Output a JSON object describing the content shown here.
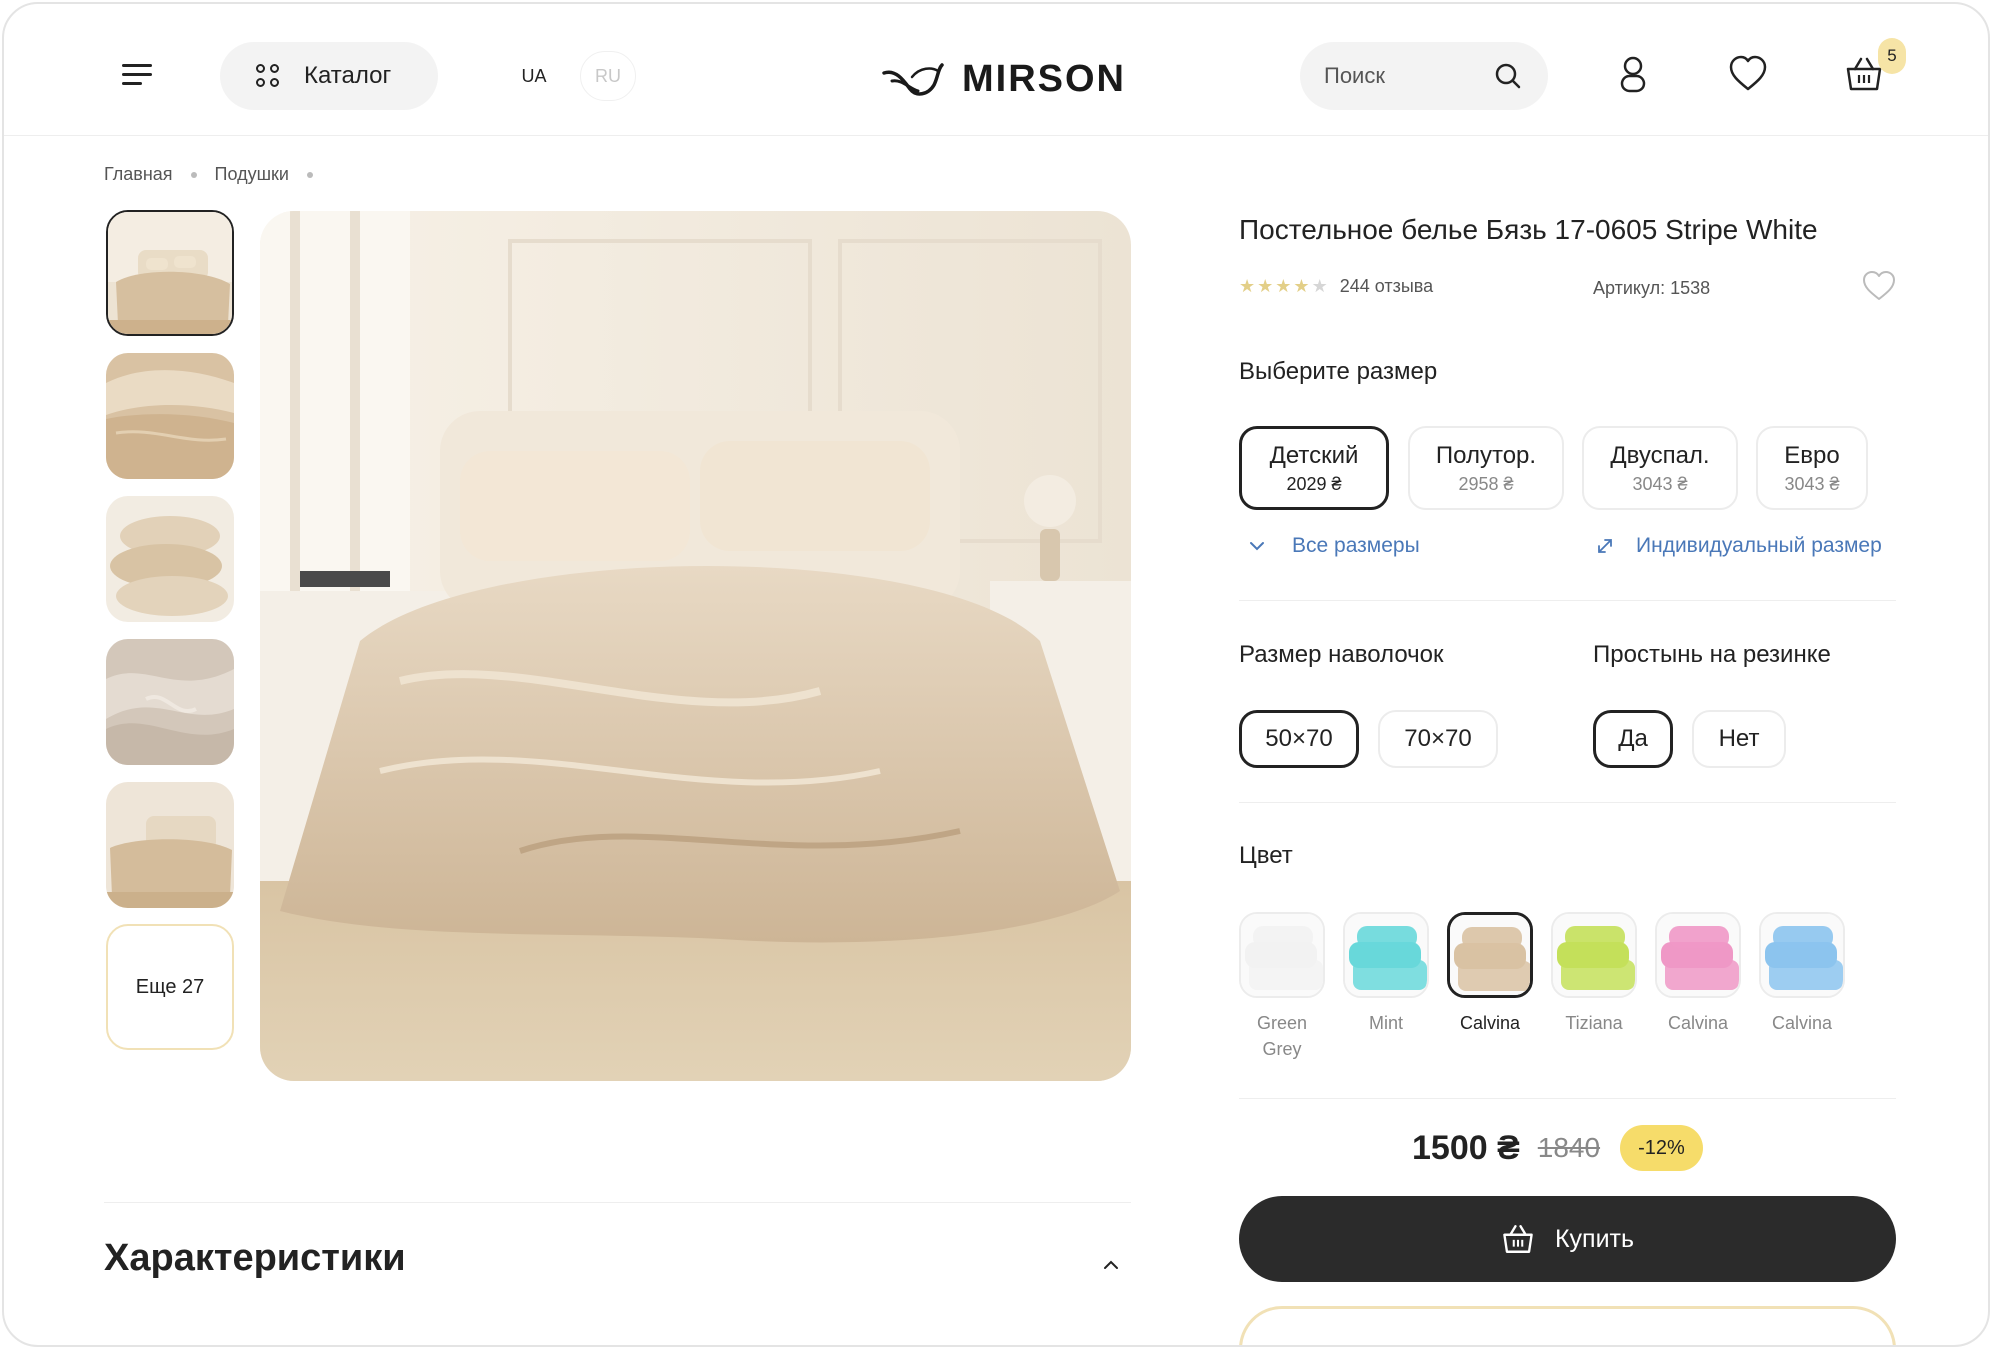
{
  "header": {
    "catalog_label": "Каталог",
    "lang_ua": "UA",
    "lang_ru": "RU",
    "logo_text": "MIRSON",
    "search_placeholder": "Поиск",
    "cart_count": "5"
  },
  "breadcrumb": {
    "items": [
      "Главная",
      "Подушки"
    ]
  },
  "gallery": {
    "more_label": "Еще 27"
  },
  "specs": {
    "title": "Характеристики"
  },
  "product": {
    "title": "Постельное белье Бязь 17-0605 Stripe White",
    "rating": 4,
    "reviews": "244 отзыва",
    "sku": "Артикул: 1538",
    "size_label": "Выберите размер",
    "sizes": [
      {
        "name": "Детский",
        "price": "2029 ₴"
      },
      {
        "name": "Полутор.",
        "price": "2958 ₴"
      },
      {
        "name": "Двуспал.",
        "price": "3043 ₴"
      },
      {
        "name": "Евро",
        "price": "3043 ₴"
      }
    ],
    "all_sizes": "Все размеры",
    "custom_size": "Индивидуальный размер",
    "pillow_label": "Размер наволочок",
    "pillow_sizes": [
      "50×70",
      "70×70"
    ],
    "elastic_label": "Простынь на резинке",
    "elastic_options": [
      "Да",
      "Нет"
    ],
    "color_label": "Цвет",
    "colors": [
      {
        "name": "Green Grey",
        "hex": "#f2f2f2"
      },
      {
        "name": "Mint",
        "hex": "#68d8da"
      },
      {
        "name": "Calvina",
        "hex": "#d9c2a3"
      },
      {
        "name": "Tiziana",
        "hex": "#c4e05a"
      },
      {
        "name": "Calvina",
        "hex": "#ef98c6"
      },
      {
        "name": "Calvina",
        "hex": "#8cc4ee"
      }
    ],
    "price": "1500 ₴",
    "old_price": "1840",
    "discount": "-12%",
    "buy_label": "Купить"
  }
}
